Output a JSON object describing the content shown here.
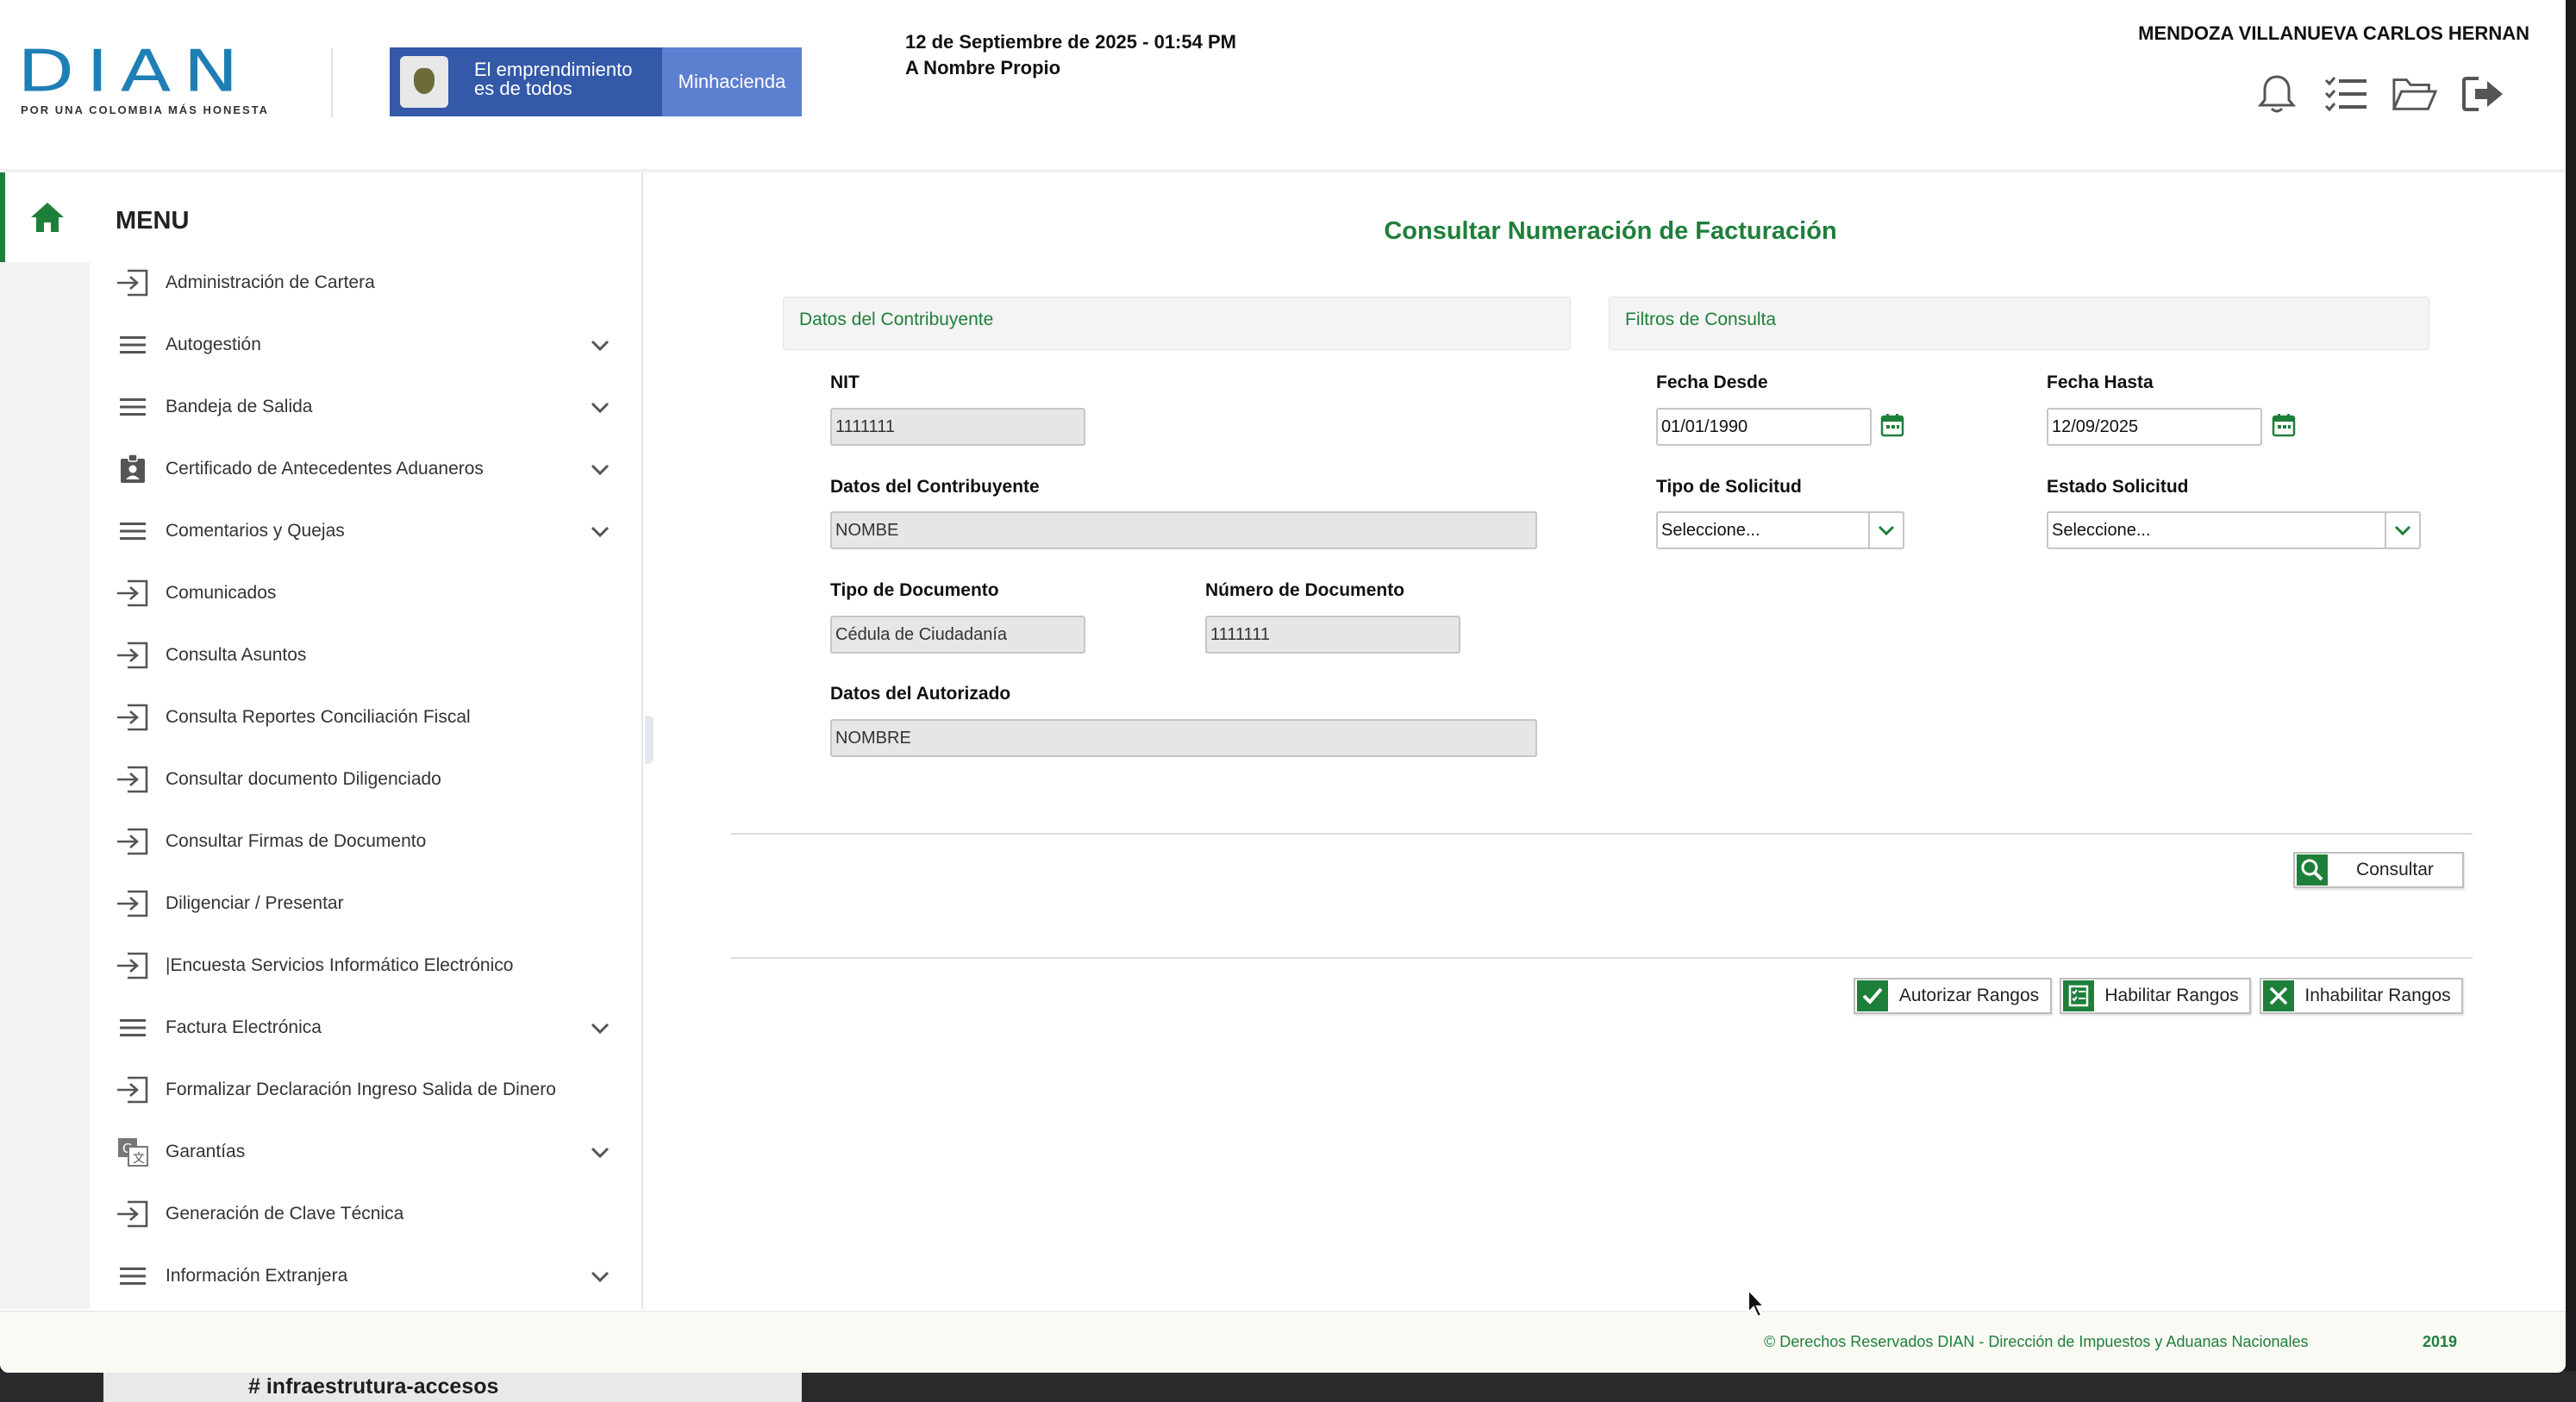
{
  "header": {
    "logo_text": "DIAN",
    "logo_tagline": "POR UNA COLOMBIA MÁS HONESTA",
    "banner_slogan": "El emprendimiento es de todos",
    "banner_ministry": "Minhacienda",
    "date_line": "12 de Septiembre de 2025 - 01:54 PM",
    "role_line": "A Nombre Propio",
    "user_name": "MENDOZA VILLANUEVA CARLOS HERNAN",
    "icons": [
      "bell-icon",
      "checklist-icon",
      "folder-open-icon",
      "logout-icon"
    ]
  },
  "sidebar": {
    "title": "MENU",
    "items": [
      {
        "label": "Administración de Cartera",
        "icon": "enter-arrow-icon",
        "expandable": false
      },
      {
        "label": "Autogestión",
        "icon": "hamburger-icon",
        "expandable": true
      },
      {
        "label": "Bandeja de Salida",
        "icon": "hamburger-icon",
        "expandable": true
      },
      {
        "label": "Certificado de Antecedentes Aduaneros",
        "icon": "badge-icon",
        "expandable": true
      },
      {
        "label": "Comentarios y Quejas",
        "icon": "hamburger-icon",
        "expandable": true
      },
      {
        "label": "Comunicados",
        "icon": "enter-arrow-icon",
        "expandable": false
      },
      {
        "label": "Consulta Asuntos",
        "icon": "enter-arrow-icon",
        "expandable": false
      },
      {
        "label": "Consulta Reportes Conciliación Fiscal",
        "icon": "enter-arrow-icon",
        "expandable": false
      },
      {
        "label": "Consultar documento Diligenciado",
        "icon": "enter-arrow-icon",
        "expandable": false
      },
      {
        "label": "Consultar Firmas de Documento",
        "icon": "enter-arrow-icon",
        "expandable": false
      },
      {
        "label": "Diligenciar / Presentar",
        "icon": "enter-arrow-icon",
        "expandable": false
      },
      {
        "label": "|Encuesta Servicios Informático Electrónico",
        "icon": "enter-arrow-icon",
        "expandable": false
      },
      {
        "label": "Factura Electrónica",
        "icon": "hamburger-icon",
        "expandable": true
      },
      {
        "label": "Formalizar Declaración Ingreso Salida de Dinero",
        "icon": "enter-arrow-icon",
        "expandable": false
      },
      {
        "label": "Garantías",
        "icon": "translate-icon",
        "expandable": true
      },
      {
        "label": "Generación de Clave Técnica",
        "icon": "enter-arrow-icon",
        "expandable": false
      },
      {
        "label": "Información Extranjera",
        "icon": "hamburger-icon",
        "expandable": true
      }
    ]
  },
  "main": {
    "title": "Consultar Numeración de Facturación",
    "section_taxpayer": "Datos del Contribuyente",
    "section_filters": "Filtros de Consulta",
    "fields": {
      "nit_label": "NIT",
      "nit_value": "1111111",
      "taxpayer_label": "Datos del Contribuyente",
      "taxpayer_value": "NOMBE",
      "doc_type_label": "Tipo de Documento",
      "doc_type_value": "Cédula de Ciudadanía",
      "doc_number_label": "Número de Documento",
      "doc_number_value": "1111111",
      "authorized_label": "Datos del Autorizado",
      "authorized_value": "NOMBRE",
      "date_from_label": "Fecha Desde",
      "date_from_value": "01/01/1990",
      "date_to_label": "Fecha Hasta",
      "date_to_value": "12/09/2025",
      "request_type_label": "Tipo de Solicitud",
      "request_type_value": "Seleccione...",
      "request_status_label": "Estado Solicitud",
      "request_status_value": "Seleccione..."
    },
    "buttons": {
      "query": "Consultar",
      "authorize": "Autorizar Rangos",
      "enable": "Habilitar Rangos",
      "disable": "Inhabilitar Rangos"
    }
  },
  "footer": {
    "copyright": "© Derechos Reservados DIAN - Dirección de Impuestos y Aduanas Nacionales",
    "year": "2019"
  },
  "background": {
    "channel_text": "#  infraestrutura-accesos"
  },
  "colors": {
    "brand_green": "#1e7f3a",
    "logo_blue": "#1e7fb5",
    "banner_blue": "#3359a8"
  }
}
